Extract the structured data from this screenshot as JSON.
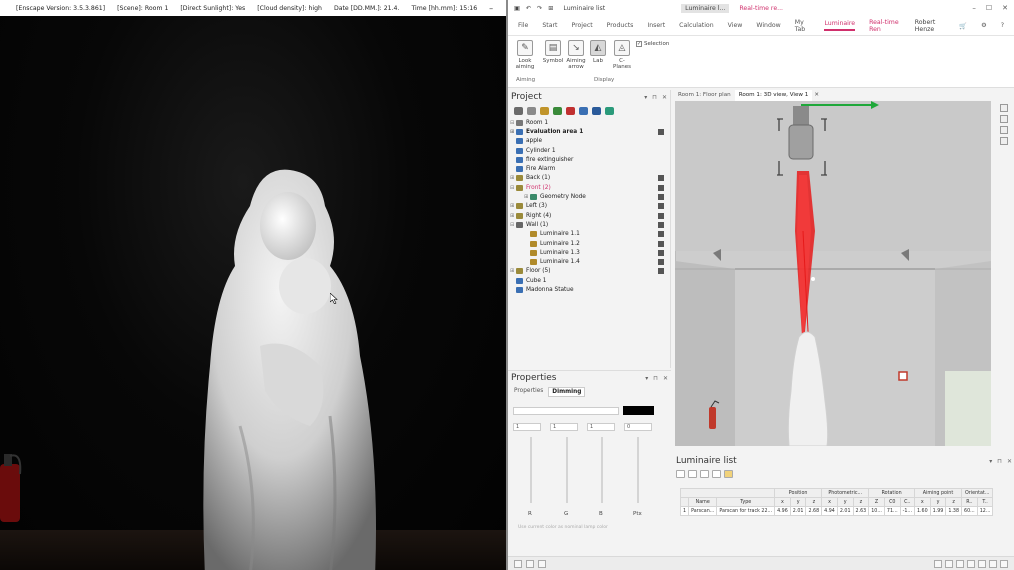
{
  "enscape": {
    "title_segments": [
      "[Enscape Version: 3.5.3.861]",
      "[Scene]: Room 1",
      "[Direct Sunlight]: Yes",
      "[Cloud density]: high",
      "Date [DD.MM.]: 21.4.",
      "Time [hh.mm]: 15:16"
    ],
    "window_controls": [
      "–",
      "☐",
      "✕"
    ]
  },
  "dialux": {
    "title": {
      "qat_label": "Luminaire list",
      "tabs": [
        "Luminaire l...",
        "Real-time re..."
      ],
      "window_controls": [
        "–",
        "☐",
        "✕"
      ]
    },
    "menu": [
      "File",
      "Start",
      "Project",
      "Products",
      "Insert",
      "Calculation",
      "View",
      "Window",
      "My Tab",
      "Luminaire",
      "Real-time Ren"
    ],
    "active_menu": "Luminaire",
    "user": "Robert Henze",
    "ribbon": {
      "buttons": [
        "Look aiming",
        "Symbol",
        "Aiming arrow",
        "Lab",
        "C-Planes"
      ],
      "selection_label": "Selection",
      "groups": [
        "Aiming",
        "Display"
      ]
    },
    "project": {
      "title": "Project",
      "tree": [
        {
          "label": "Room 1",
          "level": 0,
          "exp": "⊟",
          "color": "#777",
          "bold": false,
          "pink": false,
          "bar": false
        },
        {
          "label": "Evaluation area 1",
          "level": 0,
          "exp": "⊞",
          "color": "#3a6fb3",
          "bold": true,
          "pink": false,
          "bar": true
        },
        {
          "label": "apple",
          "level": 0,
          "exp": "",
          "color": "#3a6fb3",
          "bold": false,
          "pink": false,
          "bar": false
        },
        {
          "label": "Cylinder 1",
          "level": 0,
          "exp": "",
          "color": "#3a6fb3",
          "bold": false,
          "pink": false,
          "bar": false
        },
        {
          "label": "fire extinguisher",
          "level": 0,
          "exp": "",
          "color": "#3a6fb3",
          "bold": false,
          "pink": false,
          "bar": false
        },
        {
          "label": "Fire Alarm",
          "level": 0,
          "exp": "",
          "color": "#3a6fb3",
          "bold": false,
          "pink": false,
          "bar": false
        },
        {
          "label": "Back (1)",
          "level": 0,
          "exp": "⊞",
          "color": "#9a8a3a",
          "bold": false,
          "pink": false,
          "bar": true
        },
        {
          "label": "Front (2)",
          "level": 0,
          "exp": "⊟",
          "color": "#9a8a3a",
          "bold": false,
          "pink": true,
          "bar": true
        },
        {
          "label": "Geometry Node",
          "level": 1,
          "exp": "⊞",
          "color": "#3a8a6a",
          "bold": false,
          "pink": false,
          "bar": true
        },
        {
          "label": "Left (3)",
          "level": 0,
          "exp": "⊞",
          "color": "#9a8a3a",
          "bold": false,
          "pink": false,
          "bar": true
        },
        {
          "label": "Right (4)",
          "level": 0,
          "exp": "⊞",
          "color": "#9a8a3a",
          "bold": false,
          "pink": false,
          "bar": true
        },
        {
          "label": "Wall (1)",
          "level": 0,
          "exp": "⊟",
          "color": "#666",
          "bold": false,
          "pink": false,
          "bar": true
        },
        {
          "label": "Luminaire  1.1",
          "level": 1,
          "exp": "",
          "color": "#b08a2a",
          "bold": false,
          "pink": false,
          "bar": true
        },
        {
          "label": "Luminaire  1.2",
          "level": 1,
          "exp": "",
          "color": "#b08a2a",
          "bold": false,
          "pink": false,
          "bar": true
        },
        {
          "label": "Luminaire  1.3",
          "level": 1,
          "exp": "",
          "color": "#b08a2a",
          "bold": false,
          "pink": false,
          "bar": true
        },
        {
          "label": "Luminaire  1.4",
          "level": 1,
          "exp": "",
          "color": "#b08a2a",
          "bold": false,
          "pink": false,
          "bar": true
        },
        {
          "label": "Floor (5)",
          "level": 0,
          "exp": "⊞",
          "color": "#9a8a3a",
          "bold": false,
          "pink": false,
          "bar": true
        },
        {
          "label": "Cube 1",
          "level": 0,
          "exp": "",
          "color": "#3a6fb3",
          "bold": false,
          "pink": false,
          "bar": false
        },
        {
          "label": "Madonna Statue",
          "level": 0,
          "exp": "",
          "color": "#3a6fb3",
          "bold": false,
          "pink": false,
          "bar": false
        }
      ]
    },
    "properties": {
      "title": "Properties",
      "tabs": [
        "Properties",
        "Dimming"
      ],
      "active_tab": "Dimming",
      "spinners": [
        "1",
        "1",
        "1",
        "0"
      ],
      "slider_labels": [
        "R",
        "G",
        "B",
        "Ptx"
      ],
      "note": "Use current color as nominal lamp color"
    },
    "view_tabs": [
      "Room 1: Floor plan",
      "Room 1: 3D view, View 1"
    ],
    "active_view_tab": "Room 1: 3D view, View 1",
    "luminaire_list": {
      "title": "Luminaire list",
      "group_headers": [
        "Position",
        "Photometric...",
        "Rotation",
        "Aiming point",
        "Orientat..."
      ],
      "columns": [
        "",
        "Name",
        "Type",
        "x",
        "y",
        "z",
        "x",
        "y",
        "z",
        "Z",
        "C0",
        "C..",
        "x",
        "y",
        "z",
        "R..",
        "T.."
      ],
      "rows": [
        [
          "1",
          "Parscan...",
          "Parscan for track 22...",
          "4.96",
          "2.01",
          "2.68",
          "4.94",
          "2.01",
          "2.63",
          "10...",
          "71...",
          "-1...",
          "1.60",
          "1.99",
          "1.38",
          "60...",
          "12..."
        ]
      ]
    },
    "colors": {
      "accent": "#d0306c",
      "beam": "#e61a1a",
      "axis_green": "#1fa83a"
    }
  }
}
